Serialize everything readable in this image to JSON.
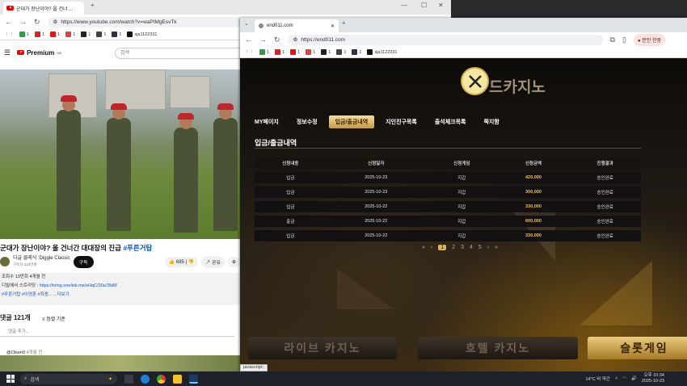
{
  "back_window": {
    "tab_title": "군대가 장난이야? 올 건너 ...",
    "url": "https://www.youtube.com/watch?v=waPtMgEsvTk",
    "bookmarks": [
      {
        "label": "1",
        "color": "#2e9d46"
      },
      {
        "label": "1",
        "color": "#d4242a"
      },
      {
        "label": "1",
        "color": "#e11"
      },
      {
        "label": "1",
        "color": "#d44"
      },
      {
        "label": "1",
        "color": "#222"
      },
      {
        "label": "1",
        "color": "#444"
      },
      {
        "label": "1",
        "color": "#334"
      },
      {
        "label": "sja1122331",
        "color": "#111"
      }
    ],
    "yt_logo": "Premium",
    "yt_region": "KR",
    "search_placeholder": "검색",
    "video_title_main": "군대가 장난이야? 올 건너간 대대장의 진급",
    "video_title_tag": "#푸른거탑",
    "channel_name": "디글 클래식 :Diggle Classic",
    "channel_subs": "구독자 318만명",
    "subscribe_label": "구독",
    "likes": "685",
    "share_label": "공유",
    "desc_line1": "조회수 13만회  4개월 전",
    "desc_line2_prefix": "디빌에서 스트리밍 :",
    "desc_link": "https://tving.onelink.me/xHqC/30a78d6f",
    "desc_tags": "#푸른거탑 #이영훈 #최종... ...더보기",
    "comment_count": "댓글 121개",
    "sort_label": "정렬 기준",
    "add_comment": "댓글 추가...",
    "first_comment_user": "@Olsen0",
    "first_comment_time": "4개월 전"
  },
  "front_window": {
    "tab_title": "end011.com",
    "url": "https://end011.com",
    "profile_label": "분인 한중",
    "bookmarks": [
      {
        "label": "1",
        "color": "#2e9d46"
      },
      {
        "label": "1",
        "color": "#d4242a"
      },
      {
        "label": "1",
        "color": "#e11"
      },
      {
        "label": "1",
        "color": "#d44"
      },
      {
        "label": "1",
        "color": "#222"
      },
      {
        "label": "1",
        "color": "#444"
      },
      {
        "label": "1",
        "color": "#334"
      },
      {
        "label": "sja1122331",
        "color": "#111"
      }
    ],
    "site_logo_text": "드카지노",
    "menu": [
      {
        "label": "MY페이지",
        "active": false
      },
      {
        "label": "정보수정",
        "active": false
      },
      {
        "label": "입금/출금내역",
        "active": true
      },
      {
        "label": "지인친구목록",
        "active": false
      },
      {
        "label": "출석체크목록",
        "active": false
      },
      {
        "label": "쪽지함",
        "active": false
      }
    ],
    "section_title": "입금/출금내역",
    "table_headers": [
      "신청내용",
      "신청일자",
      "신청게임",
      "신청금액",
      "진행결과"
    ],
    "table_rows": [
      [
        "입금",
        "2025-10-23",
        "지갑",
        "420,000",
        "승인완료"
      ],
      [
        "입금",
        "2025-10-23",
        "지갑",
        "300,000",
        "승인완료"
      ],
      [
        "입금",
        "2025-10-22",
        "지갑",
        "330,000",
        "승인완료"
      ],
      [
        "출금",
        "2025-10-22",
        "지갑",
        "600,000",
        "승인완료"
      ],
      [
        "입금",
        "2025-10-22",
        "지갑",
        "330,000",
        "승인완료"
      ]
    ],
    "pager": [
      "«",
      "‹",
      "1",
      "2",
      "3",
      "4",
      "5",
      "›",
      "»"
    ],
    "bottom_buttons": [
      "라이브 카지노",
      "호텔 카지노",
      "슬롯게임"
    ],
    "status_bar": "javascript:;"
  },
  "taskbar": {
    "search_placeholder": "검색",
    "weather": "14°C 비 약간",
    "time": "오후 10:34",
    "date": "2025-10-23"
  }
}
